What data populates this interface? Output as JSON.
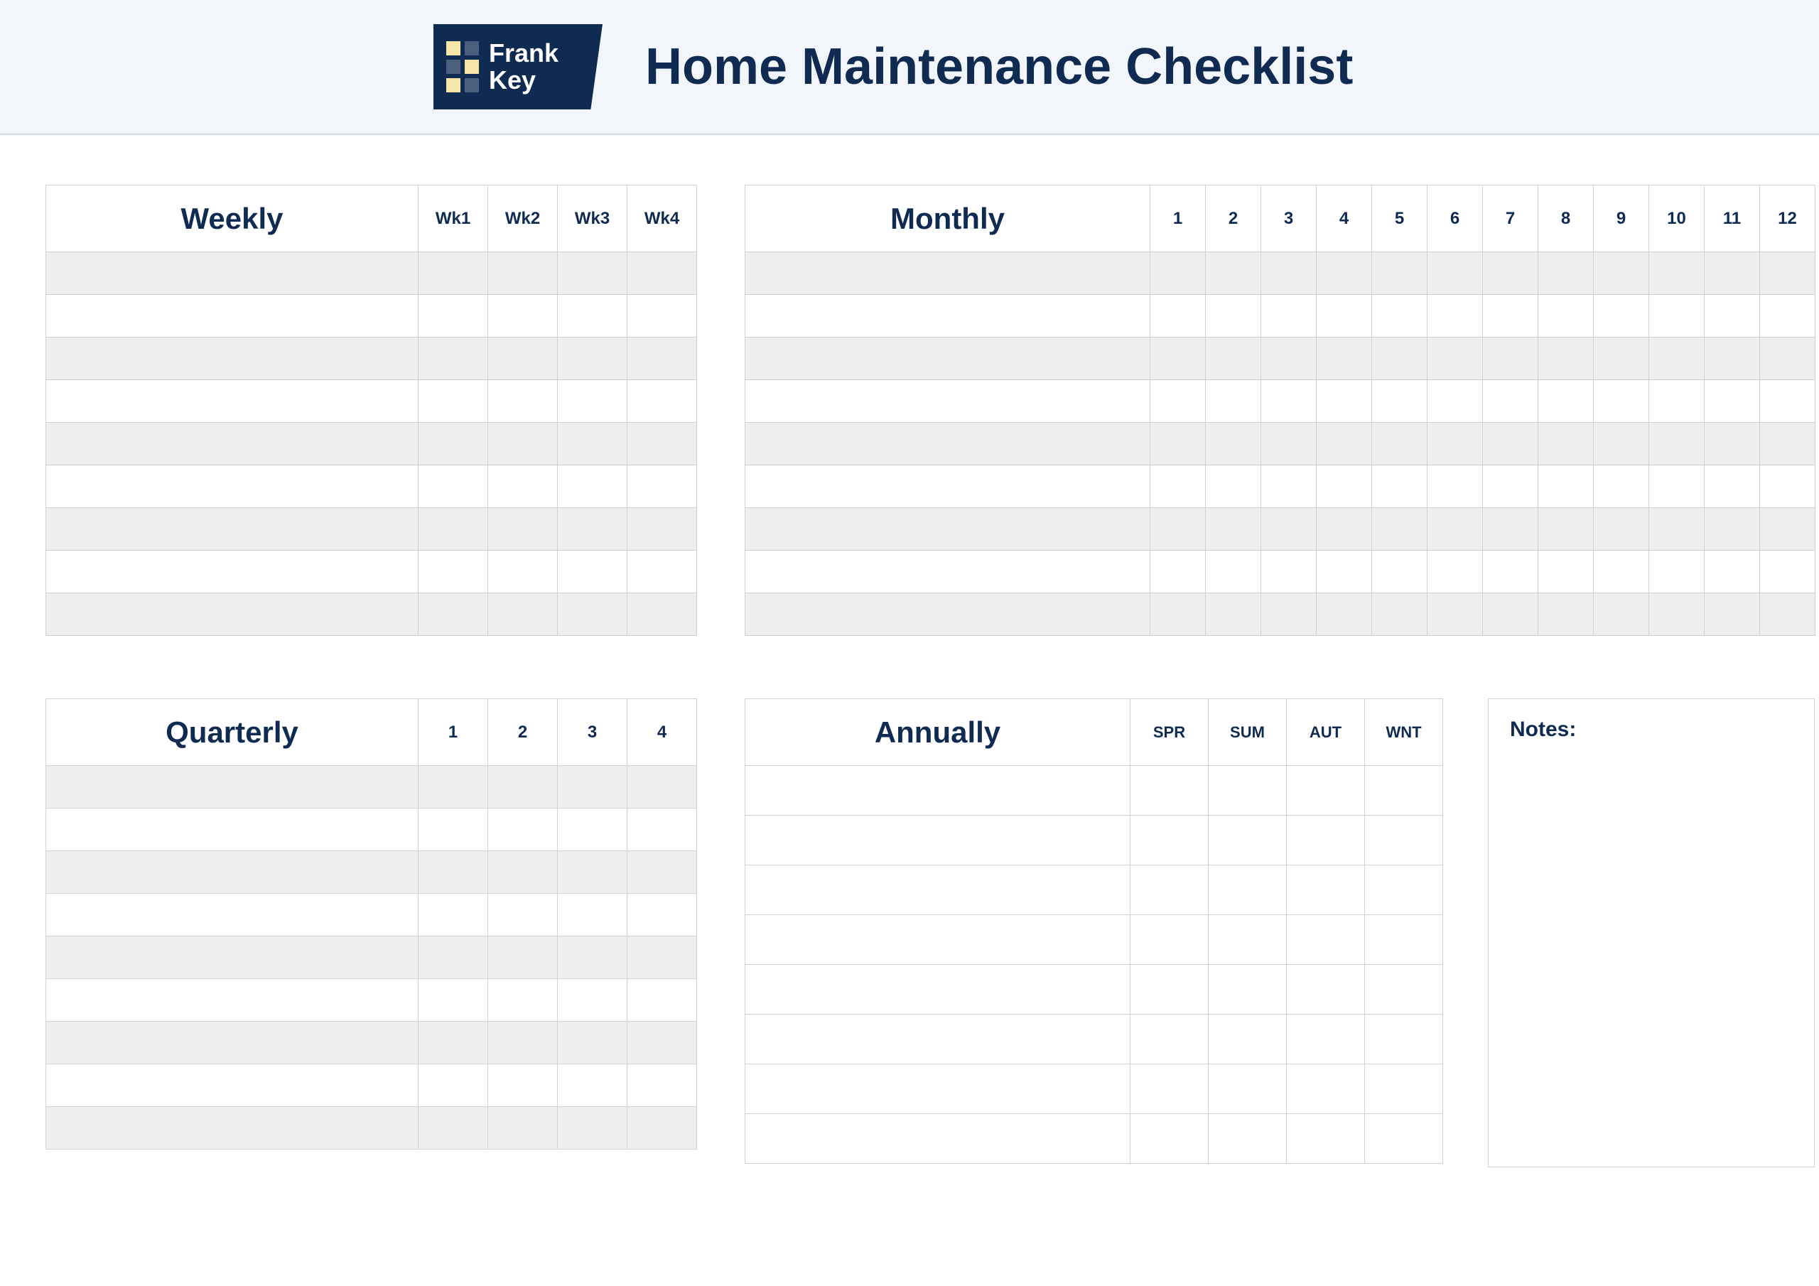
{
  "brand": {
    "line1": "Frank",
    "line2": "Key"
  },
  "title": "Home Maintenance Checklist",
  "weekly": {
    "title": "Weekly",
    "columns": [
      "Wk1",
      "Wk2",
      "Wk3",
      "Wk4"
    ],
    "rows": 9,
    "striped": true
  },
  "monthly": {
    "title": "Monthly",
    "columns": [
      "1",
      "2",
      "3",
      "4",
      "5",
      "6",
      "7",
      "8",
      "9",
      "10",
      "11",
      "12"
    ],
    "rows": 9,
    "striped": true
  },
  "quarterly": {
    "title": "Quarterly",
    "columns": [
      "1",
      "2",
      "3",
      "4"
    ],
    "rows": 9,
    "striped": true
  },
  "annually": {
    "title": "Annually",
    "columns": [
      "SPR",
      "SUM",
      "AUT",
      "WNT"
    ],
    "rows": 8,
    "striped": false
  },
  "notes": {
    "title": "Notes:"
  }
}
